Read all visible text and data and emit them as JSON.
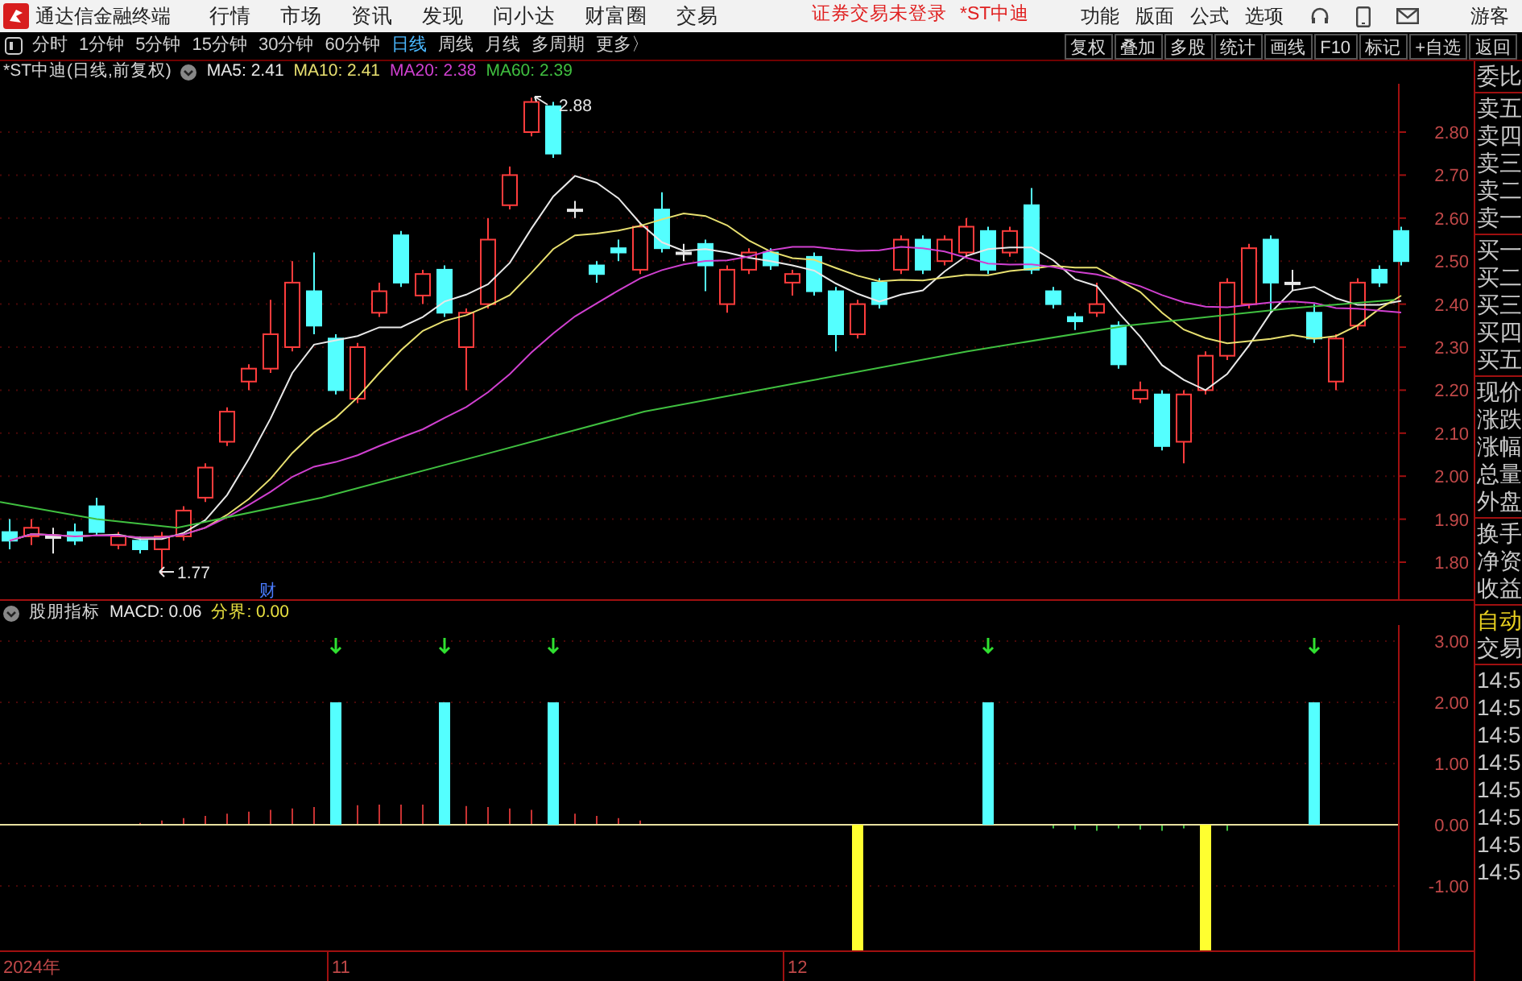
{
  "top_bar": {
    "app_title": "通达信金融终端",
    "menu": [
      "行情",
      "市场",
      "资讯",
      "发现",
      "问小达",
      "财富圈",
      "交易"
    ],
    "notices": [
      "证券交易未登录",
      "*ST中迪"
    ],
    "right_menu": [
      "功能",
      "版面",
      "公式",
      "选项"
    ],
    "user": "游客"
  },
  "toolbar": {
    "periods": [
      {
        "label": "分时",
        "selected": false
      },
      {
        "label": "1分钟",
        "selected": false
      },
      {
        "label": "5分钟",
        "selected": false
      },
      {
        "label": "15分钟",
        "selected": false
      },
      {
        "label": "30分钟",
        "selected": false
      },
      {
        "label": "60分钟",
        "selected": false
      },
      {
        "label": "日线",
        "selected": true
      },
      {
        "label": "周线",
        "selected": false
      },
      {
        "label": "月线",
        "selected": false
      },
      {
        "label": "多周期",
        "selected": false
      }
    ],
    "more": "更多〉",
    "buttons": [
      "复权",
      "叠加",
      "多股",
      "统计",
      "画线",
      "F10",
      "标记",
      "+自选",
      "返回"
    ]
  },
  "price_chart": {
    "title": "*ST中迪(日线,前复权)",
    "legend": [
      {
        "label": "MA5: 2.41",
        "color": "#e8e8e8"
      },
      {
        "label": "MA10: 2.41",
        "color": "#e8e070"
      },
      {
        "label": "MA20: 2.38",
        "color": "#d040d0"
      },
      {
        "label": "MA60: 2.39",
        "color": "#40c040"
      }
    ],
    "high_label": "2.88",
    "low_label": "1.77",
    "event_mark": "财",
    "y_ticks": [
      "2.80",
      "2.70",
      "2.60",
      "2.50",
      "2.40",
      "2.30",
      "2.20",
      "2.10",
      "2.00",
      "1.90",
      "1.80"
    ]
  },
  "indicator_chart": {
    "name": "股朋指标",
    "legend": [
      {
        "label": "MACD: 0.06",
        "color": "#e8e8e8"
      },
      {
        "label": "分界: 0.00",
        "color": "#e8e040"
      }
    ],
    "y_ticks": [
      "3.00",
      "2.00",
      "1.00",
      "0.00",
      "-1.00"
    ]
  },
  "date_axis": [
    "2024年",
    "11",
    "12"
  ],
  "side_panel": [
    [
      {
        "label": "委比",
        "kind": "plain"
      }
    ],
    [
      {
        "label": "卖五",
        "kind": "plain"
      },
      {
        "label": "卖四",
        "kind": "plain"
      },
      {
        "label": "卖三",
        "kind": "plain"
      },
      {
        "label": "卖二",
        "kind": "plain"
      },
      {
        "label": "卖一",
        "kind": "plain"
      }
    ],
    [
      {
        "label": "买一",
        "kind": "plain"
      },
      {
        "label": "买二",
        "kind": "plain"
      },
      {
        "label": "买三",
        "kind": "plain"
      },
      {
        "label": "买四",
        "kind": "plain"
      },
      {
        "label": "买五",
        "kind": "plain"
      }
    ],
    [
      {
        "label": "现价",
        "kind": "plain"
      },
      {
        "label": "涨跌",
        "kind": "plain"
      },
      {
        "label": "涨幅",
        "kind": "plain"
      },
      {
        "label": "总量",
        "kind": "plain"
      },
      {
        "label": "外盘",
        "kind": "plain"
      }
    ],
    [
      {
        "label": "换手",
        "kind": "plain"
      },
      {
        "label": "净资",
        "kind": "plain"
      },
      {
        "label": "收益",
        "kind": "plain"
      }
    ],
    [
      {
        "label": "自动",
        "kind": "highlight"
      },
      {
        "label": "交易",
        "kind": "plain"
      }
    ],
    [
      {
        "label": "14:5",
        "kind": "plain"
      },
      {
        "label": "14:5",
        "kind": "plain"
      },
      {
        "label": "14:5",
        "kind": "plain"
      },
      {
        "label": "14:5",
        "kind": "plain"
      },
      {
        "label": "14:5",
        "kind": "plain"
      },
      {
        "label": "14:5",
        "kind": "plain"
      },
      {
        "label": "14:5",
        "kind": "plain"
      },
      {
        "label": "14:5",
        "kind": "plain"
      }
    ]
  ]
}
